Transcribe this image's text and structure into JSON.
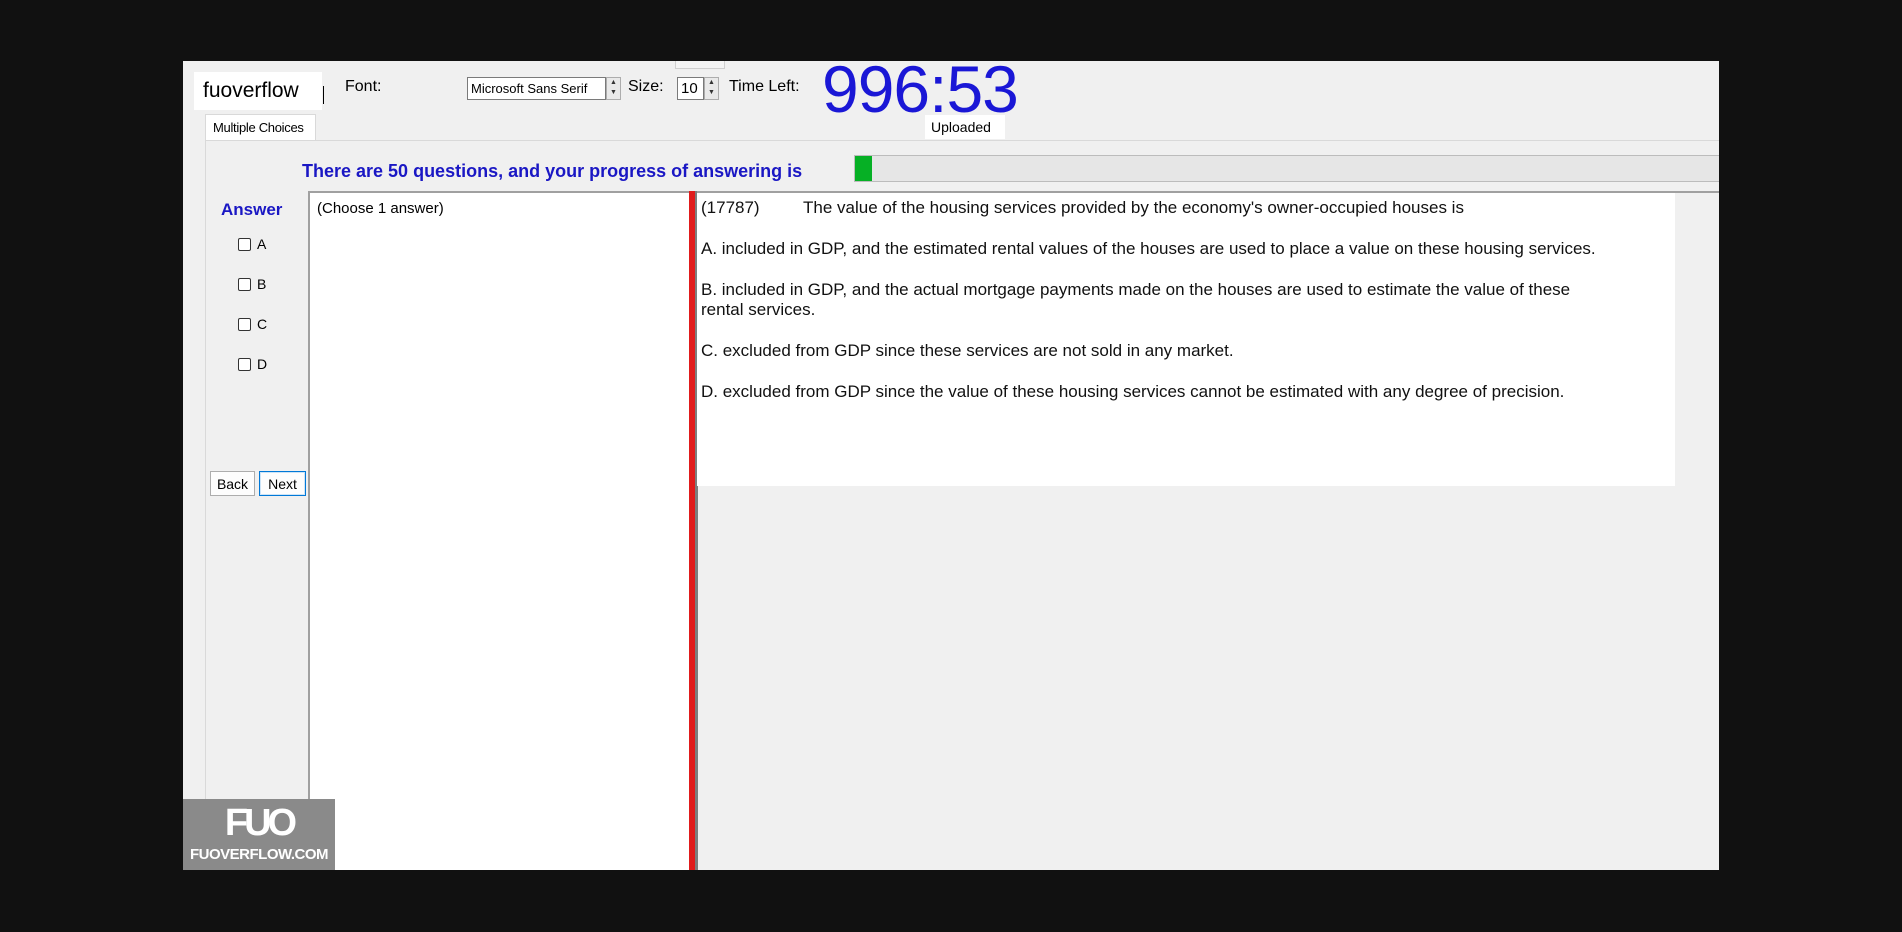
{
  "toolbar": {
    "brand_text": "fuoverflow",
    "font_label": "Font:",
    "font_value": "Microsoft Sans Serif",
    "size_label": "Size:",
    "size_value": "10",
    "time_label": "Time Left:",
    "timer": "996:53"
  },
  "tabs": {
    "multiple_choices": "Multiple Choices",
    "status": "Uploaded"
  },
  "progress": {
    "text": "There are 50 questions, and your progress of answering is",
    "fraction": 0.02
  },
  "answer": {
    "title": "Answer",
    "options": [
      "A",
      "B",
      "C",
      "D"
    ]
  },
  "nav": {
    "back": "Back",
    "next": "Next"
  },
  "choose_hint": "(Choose 1 answer)",
  "question": {
    "id": "(17787)",
    "text": "The value of the housing services provided by the economy's owner-occupied houses is",
    "options": [
      "A.  included in GDP, and the estimated rental values of the houses are used to place a value on these housing services.",
      "B.  included in GDP, and the actual mortgage payments made on the houses are used to estimate the value of these rental services.",
      "C.  excluded from GDP since these services are not sold in any market.",
      "D.  excluded from GDP since the value of these housing services cannot be estimated with any degree of precision."
    ]
  },
  "watermark": {
    "logo": "FUO",
    "site": "FUOVERFLOW.COM"
  },
  "colors": {
    "timer": "#1a17d6",
    "heading_blue": "#1a17c4",
    "progress_green": "#06b025",
    "splitter_red": "#e01b1b"
  }
}
